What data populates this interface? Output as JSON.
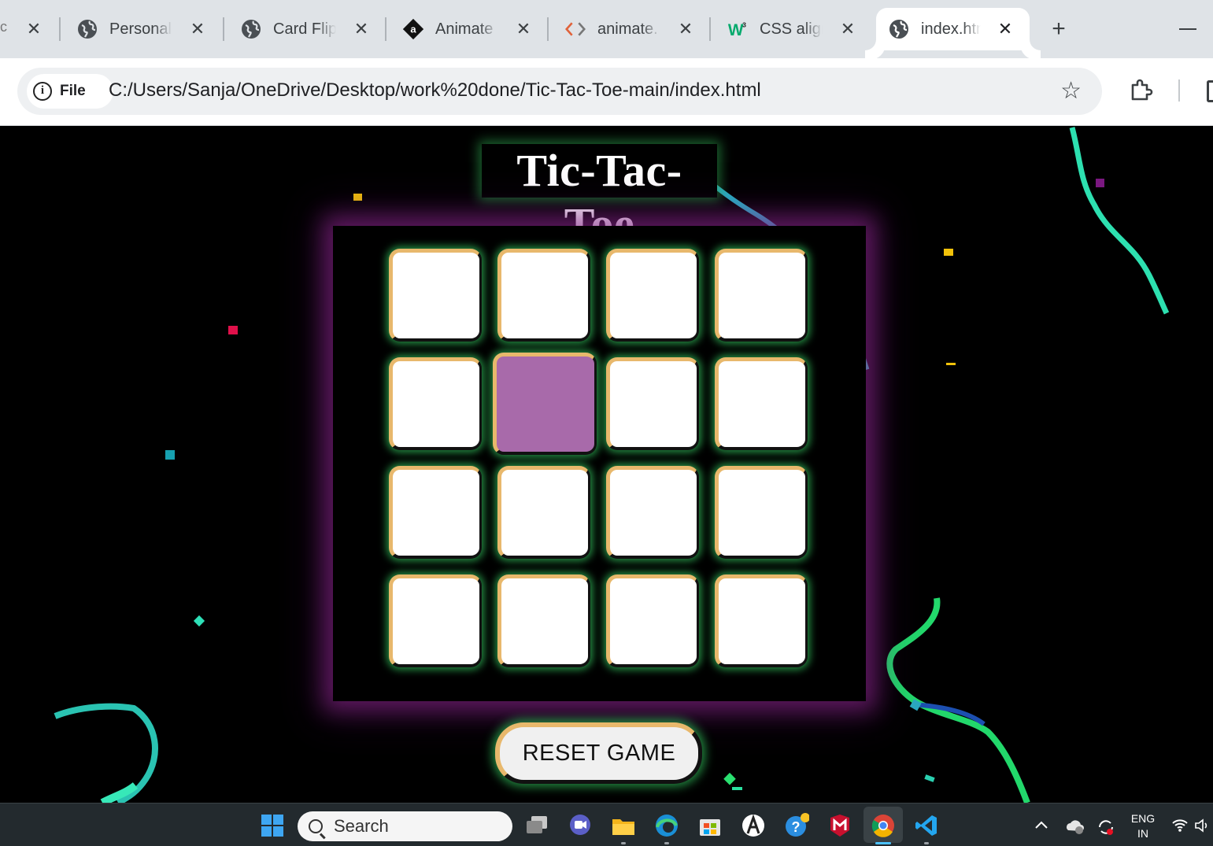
{
  "browser": {
    "tabs": [
      {
        "title": "Personal",
        "icon": "globe-icon"
      },
      {
        "title": "Card Flip",
        "icon": "globe-icon"
      },
      {
        "title": "Animate",
        "icon": "animate-icon"
      },
      {
        "title": "animate.",
        "icon": "code-icon"
      },
      {
        "title": "CSS align",
        "icon": "w3schools-icon"
      },
      {
        "title": "index.html",
        "icon": "globe-icon",
        "active": true
      }
    ],
    "new_tab": "+",
    "site_info_label": "File",
    "url": "C:/Users/Sanja/OneDrive/Desktop/work%20done/Tic-Tac-Toe-main/index.html"
  },
  "game": {
    "title": "Tic-Tac-Toe",
    "board_size": 4,
    "selected_cell": {
      "row": 2,
      "col": 2
    },
    "reset_label": "RESET GAME"
  },
  "taskbar": {
    "search_placeholder": "Search",
    "language": "ENG",
    "region": "IN"
  },
  "colors": {
    "cell": "#ffffff",
    "cell_selected": "#a86aaa",
    "cell_border_light": "#e8b86c",
    "glow_green": "#2ea850",
    "board_glow": "#962896",
    "page_bg": "#000000"
  }
}
